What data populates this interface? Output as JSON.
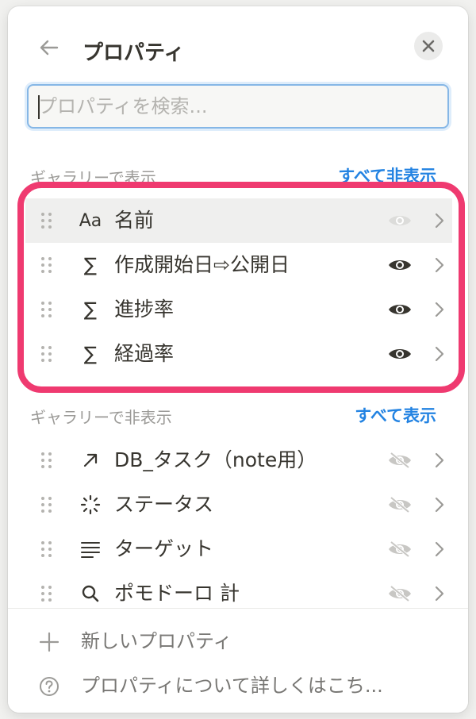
{
  "header": {
    "title": "プロパティ",
    "back_icon": "arrow-left-icon",
    "close_icon": "close-icon"
  },
  "search": {
    "placeholder": "プロパティを検索...",
    "value": ""
  },
  "visible_section": {
    "label": "ギャラリーで表示",
    "action": "すべて非表示",
    "items": [
      {
        "icon": "Aa",
        "icon_name": "text-type-icon",
        "label": "名前",
        "visible": true,
        "eye_state": "disabled"
      },
      {
        "icon": "∑",
        "icon_name": "formula-icon",
        "label": "作成開始日⇨公開日",
        "visible": true,
        "eye_state": "on"
      },
      {
        "icon": "∑",
        "icon_name": "formula-icon",
        "label": "進捗率",
        "visible": true,
        "eye_state": "on"
      },
      {
        "icon": "∑",
        "icon_name": "formula-icon",
        "label": "経過率",
        "visible": true,
        "eye_state": "on"
      }
    ]
  },
  "hidden_section": {
    "label": "ギャラリーで非表示",
    "action": "すべて表示",
    "items": [
      {
        "icon_name": "relation-arrow-icon",
        "label": "DB_タスク（note用）",
        "visible": false
      },
      {
        "icon_name": "status-icon",
        "label": "ステータス",
        "visible": false
      },
      {
        "icon_name": "text-lines-icon",
        "label": "ターゲット",
        "visible": false
      },
      {
        "icon_name": "rollup-search-icon",
        "label": "ポモドーロ 計",
        "visible": false
      }
    ]
  },
  "footer": {
    "new_property": "新しいプロパティ",
    "learn_more": "プロパティについて詳しくはこち..."
  },
  "colors": {
    "accent": "#2383e2",
    "highlight_border": "#ef3a70",
    "text": "#37352f",
    "muted": "#9b9a97"
  }
}
